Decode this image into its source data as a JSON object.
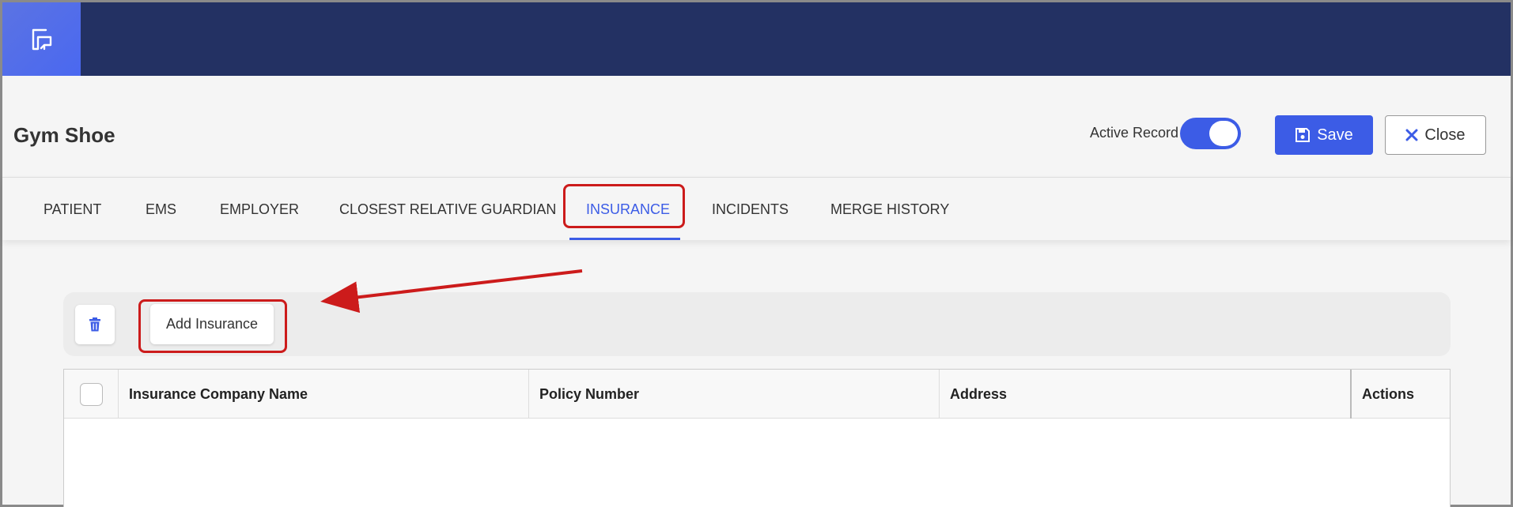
{
  "header": {
    "title": "Gym Shoe",
    "active_record_label": "Active Record",
    "active_record_on": true,
    "save_label": "Save",
    "close_label": "Close"
  },
  "tabs": [
    {
      "label": "PATIENT",
      "active": false
    },
    {
      "label": "EMS",
      "active": false
    },
    {
      "label": "EMPLOYER",
      "active": false
    },
    {
      "label": "CLOSEST RELATIVE GUARDIAN",
      "active": false
    },
    {
      "label": "INSURANCE",
      "active": true
    },
    {
      "label": "INCIDENTS",
      "active": false
    },
    {
      "label": "MERGE HISTORY",
      "active": false
    }
  ],
  "toolbar": {
    "add_label": "Add Insurance"
  },
  "table": {
    "columns": [
      "Insurance Company Name",
      "Policy Number",
      "Address",
      "Actions"
    ],
    "rows": []
  },
  "colors": {
    "topbar": "#233163",
    "accent": "#3c5ce6",
    "annotation": "#cc1b1b"
  },
  "icons": [
    "logo-icon",
    "save-icon",
    "close-icon",
    "trash-icon"
  ]
}
